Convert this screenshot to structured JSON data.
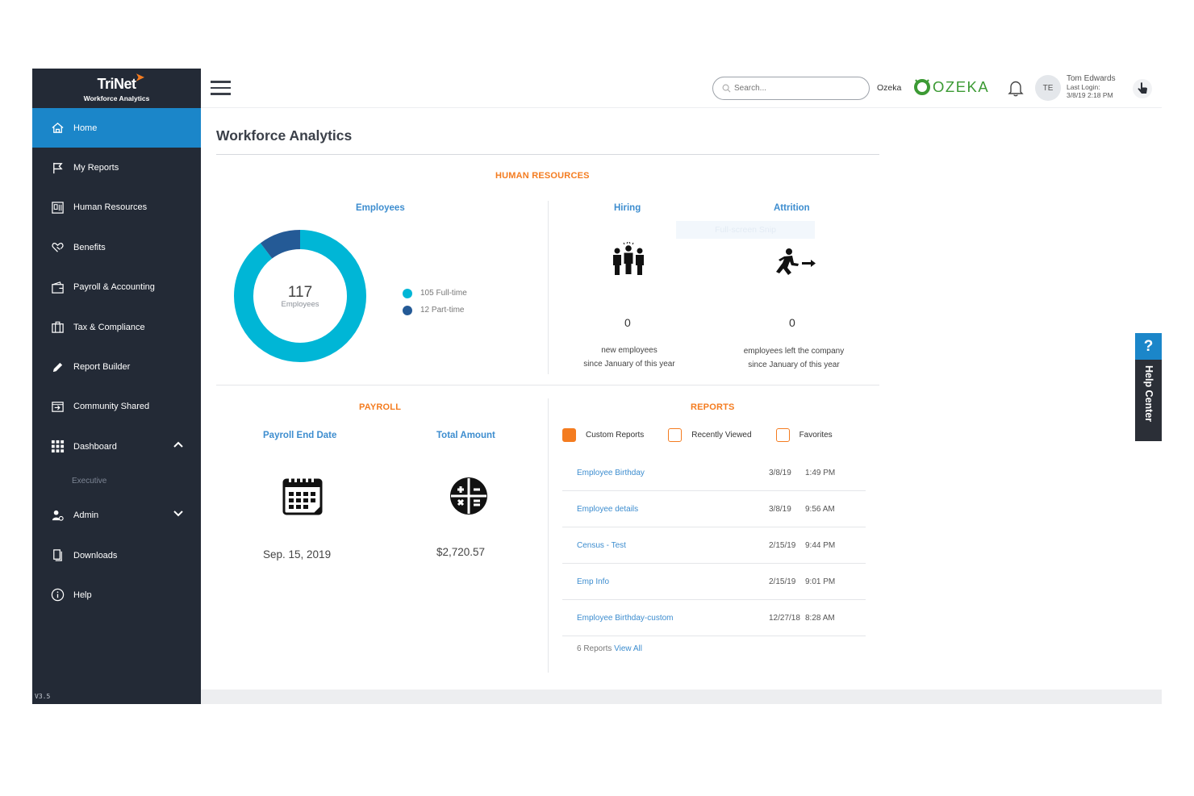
{
  "brand": {
    "name": "TriNet",
    "subtitle": "Workforce Analytics",
    "accent": "#f47c20"
  },
  "sidebar": {
    "items": [
      {
        "label": "Home",
        "icon": "home-icon",
        "active": true
      },
      {
        "label": "My Reports",
        "icon": "flag-icon"
      },
      {
        "label": "Human Resources",
        "icon": "id-card-icon"
      },
      {
        "label": "Benefits",
        "icon": "heart-hand-icon"
      },
      {
        "label": "Payroll & Accounting",
        "icon": "wallet-icon"
      },
      {
        "label": "Tax & Compliance",
        "icon": "briefcase-icon"
      },
      {
        "label": "Report Builder",
        "icon": "pencil-icon"
      },
      {
        "label": "Community Shared",
        "icon": "share-icon"
      },
      {
        "label": "Dashboard",
        "icon": "grid-icon",
        "expanded": true
      },
      {
        "label": "Admin",
        "icon": "admin-icon",
        "expanded": false
      },
      {
        "label": "Downloads",
        "icon": "download-icon"
      },
      {
        "label": "Help",
        "icon": "info-icon"
      }
    ],
    "dashboard_sub": "Executive",
    "version": "V3.5"
  },
  "header": {
    "search_placeholder": "Search...",
    "company_label": "Ozeka",
    "logo_text": "OZEKA",
    "avatar_initials": "TE",
    "user_name": "Tom Edwards",
    "last_login_label": "Last Login:",
    "last_login_value": "3/8/19 2:18 PM"
  },
  "page": {
    "title": "Workforce Analytics"
  },
  "hr": {
    "section_title": "HUMAN RESOURCES",
    "employees": {
      "title": "Employees",
      "total": "117",
      "total_label": "Employees",
      "segments": [
        {
          "label": "Full-time",
          "count": "105",
          "value": 105,
          "color": "#00b6d6"
        },
        {
          "label": "Part-time",
          "count": "12",
          "value": 12,
          "color": "#245a96"
        }
      ]
    },
    "hiring": {
      "title": "Hiring",
      "value": "0",
      "desc_line1": "new employees",
      "desc_line2": "since January of this year"
    },
    "attrition": {
      "title": "Attrition",
      "value": "0",
      "desc_line1": "employees left the company",
      "desc_line2": "since January of this year"
    }
  },
  "snip_overlay": "Full-screen Snip",
  "payroll": {
    "section_title": "PAYROLL",
    "end_date_title": "Payroll End Date",
    "end_date_value": "Sep. 15, 2019",
    "total_title": "Total Amount",
    "total_value": "$2,720.57"
  },
  "reports": {
    "section_title": "REPORTS",
    "filters": [
      {
        "label": "Custom Reports",
        "checked": true
      },
      {
        "label": "Recently Viewed",
        "checked": false
      },
      {
        "label": "Favorites",
        "checked": false
      }
    ],
    "rows": [
      {
        "name": "Employee Birthday",
        "date": "3/8/19",
        "time": "1:49 PM"
      },
      {
        "name": "Employee details",
        "date": "3/8/19",
        "time": "9:56 AM"
      },
      {
        "name": "Census - Test",
        "date": "2/15/19",
        "time": "9:44 PM"
      },
      {
        "name": "Emp Info",
        "date": "2/15/19",
        "time": "9:01 PM"
      },
      {
        "name": "Employee Birthday-custom",
        "date": "12/27/18",
        "time": "8:28 AM"
      }
    ],
    "count_text": "6 Reports",
    "view_all": "View All"
  },
  "help_tab": {
    "icon": "?",
    "label": "Help Center"
  }
}
